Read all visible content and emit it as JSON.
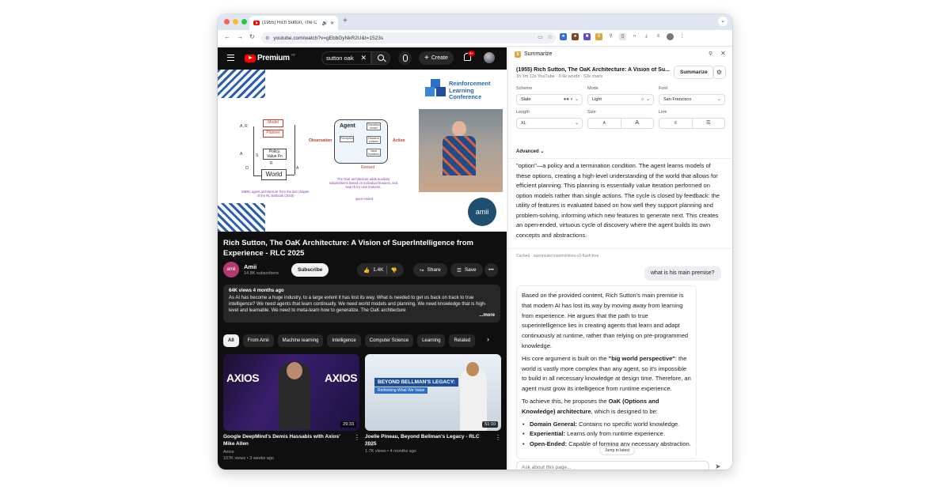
{
  "browser": {
    "tab_title": "(1955) Rich Sutton, The C",
    "url": "youtube.com/watch?v=gEbbGyNkR2U&t=1523s",
    "colors": {
      "close": "#ff5f57",
      "minimize": "#febc2e",
      "maximize": "#28c840"
    }
  },
  "youtube": {
    "logo_text": "Premium",
    "logo_region": "AT",
    "search_value": "sutton oak",
    "create_label": "Create",
    "notif_count": "9+",
    "slide": {
      "conf_name": [
        "Reinforcement",
        "Learning",
        "Conference"
      ],
      "model": "Model",
      "planner": "Planner",
      "policy": "Policy,",
      "value_fn": "Value Fn",
      "world": "World",
      "agent": "Agent",
      "observation": "Observation",
      "action": "Action",
      "reward": "Reward",
      "caption_left": "MBRL agent architecture from the last chapter of the RL textbook (2018)",
      "caption_right": "The OaK architecture adds auxiliary subproblems based on individual features, and search for new features.",
      "open_ended": "open-ended",
      "label_ar": "A, R",
      "label_a": "A",
      "label_s": "S",
      "label_o": "O",
      "label_r": "R",
      "label_a2": "A",
      "mini_perception": "Perception",
      "mini_transition": "Transition model",
      "mini_reactive": "Reactive policies",
      "mini_value": "Value functions",
      "badge": "amii"
    },
    "video_title": "Rich Sutton, The OaK Architecture: A Vision of SuperIntelligence from Experience - RLC 2025",
    "channel": {
      "avatar": "amii",
      "name": "Amii",
      "subs": "14.8K subscribers"
    },
    "subscribe_label": "Subscribe",
    "likes": "1.4K",
    "share_label": "Share",
    "save_label": "Save",
    "description": {
      "meta": "64K views  4 months ago",
      "text": "As AI has become a huge industry, to a large extent it has lost its way. What is needed to get us back on track to true intelligence? We need agents that learn continually. We need world models and planning. We need knowledge that is high-level and learnable. We need to meta-learn how to generalize. The OaK architecture",
      "more": "...more"
    },
    "chips": [
      "All",
      "From Amii",
      "Machine learning",
      "Intelligence",
      "Computer Science",
      "Learning",
      "Related"
    ],
    "recommendations": [
      {
        "title": "Google DeepMind's Demis Hassabis with Axios' Mike Allen",
        "channel": "Axios",
        "meta": "107K views • 3 weeks ago",
        "duration": "29:33",
        "thumb_text": "AXIOS"
      },
      {
        "title": "Joelle Pineau, Beyond Bellman's Legacy - RLC 2025",
        "channel": "Amii",
        "meta": "1.7K views • 4 months ago",
        "duration": "51:10",
        "thumb_text": "BEYOND BELLMAN'S LEGACY:",
        "thumb_sub": "Rethinking What We Value"
      }
    ]
  },
  "panel": {
    "app_title": "Summarize",
    "logo_letter": "S",
    "video_title": "(1955) Rich Sutton, The OaK Architecture: A Vision of Su...",
    "video_sub": "1h 1m 12s YouTube · 9.6k words · 52k chars",
    "summarize_label": "Summarize",
    "controls": {
      "scheme_label": "Scheme",
      "scheme_value": "Slate",
      "mode_label": "Mode",
      "mode_value": "Light",
      "font_label": "Font",
      "font_value": "San Francisco",
      "length_label": "Length",
      "length_value": "XL",
      "size_label": "Size",
      "size_small": "A",
      "size_large": "A",
      "line_label": "Line"
    },
    "advanced_label": "Advanced",
    "summary_text": "\"option\"—a policy and a termination condition. The agent learns models of these options, creating a high-level understanding of the world that allows for efficient planning. This planning is essentially value iteration performed on option models rather than single actions. The cycle is closed by feedback: the utility of features is evaluated based on how well they support planning and problem-solving, informing which new features to generate next. This creates an open-ended, virtuous cycle of discovery where the agent builds its own concepts and abstractions.",
    "cached_note": "Cached · openrouter/xiaomi/mimo-v2-flash:free",
    "user_question": "what is his main premise?",
    "answer": {
      "p1": "Based on the provided content, Rich Sutton's main premise is that modern AI has lost its way by moving away from learning from experience. He argues that the path to true superintelligence lies in creating agents that learn and adapt continuously at runtime, rather than relying on pre-programmed knowledge.",
      "p2_pre": "His core argument is built on the ",
      "p2_bold": "\"big world perspective\"",
      "p2_post": ": the world is vastly more complex than any agent, so it's impossible to build in all necessary knowledge at design time. Therefore, an agent must grow its intelligence from runtime experience.",
      "p3_pre": "To achieve this, he proposes the ",
      "p3_bold": "OaK (Options and Knowledge) architecture",
      "p3_post": ", which is designed to be:",
      "bullets": [
        {
          "term": "Domain General:",
          "text": " Contains no specific world knowledge."
        },
        {
          "term": "Experiential:",
          "text": " Learns only from runtime experience."
        },
        {
          "term": "Open-Ended:",
          "text": " Capable of forming any necessary abstraction."
        }
      ]
    },
    "jump_label": "Jump to latest",
    "ask_placeholder": "Ask about this page..."
  }
}
